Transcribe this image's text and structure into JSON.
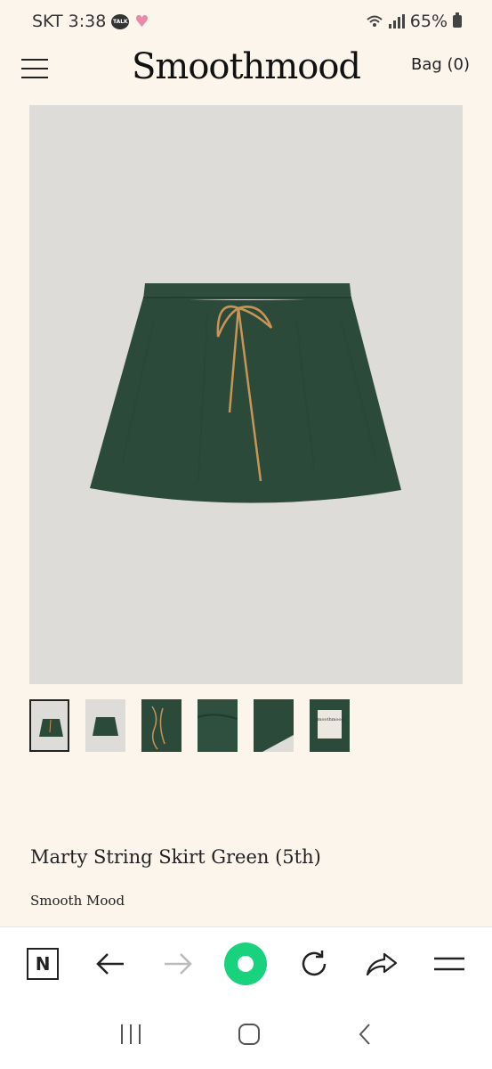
{
  "status": {
    "carrier": "SKT",
    "time": "3:38",
    "talk_badge": "TALK",
    "battery": "65%"
  },
  "header": {
    "logo": "Smoothmood",
    "bag": "Bag (0)"
  },
  "gallery": {
    "main_image": "green-skirt-image",
    "thumbnail_count": 6,
    "selected_thumbnail": 1
  },
  "thumb_tag": {
    "label": "smoothmood"
  },
  "product": {
    "title": "Marty String Skirt Green (5th)",
    "brand": "Smooth Mood"
  },
  "colors": {
    "background": "#fbf5ec",
    "skirt": "#2c4a3a",
    "string": "#c99455",
    "accent_green": "#18d27d"
  },
  "browser_toolbar": [
    "naver-n-icon",
    "back-arrow-icon",
    "forward-arrow-icon",
    "green-home-icon",
    "refresh-icon",
    "share-icon",
    "menu-icon"
  ],
  "system_nav": [
    "recent-apps-icon",
    "home-icon",
    "back-icon"
  ]
}
